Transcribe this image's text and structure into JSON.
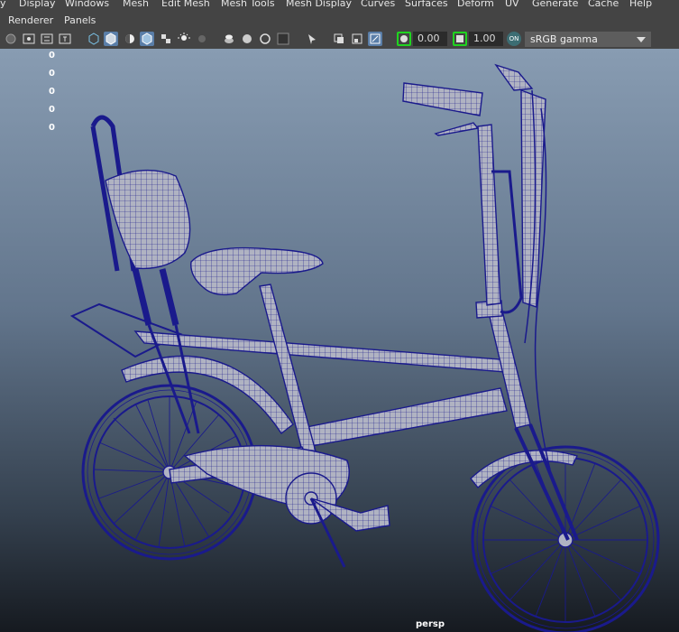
{
  "menu": {
    "items": [
      "y",
      "Display",
      "Windows",
      "Mesh",
      "Edit Mesh",
      "Mesh Tools",
      "Mesh Display",
      "Curves",
      "Surfaces",
      "Deform",
      "UV",
      "Generate",
      "Cache",
      "Help"
    ]
  },
  "panel_menu": {
    "items": [
      "Renderer",
      "Panels"
    ]
  },
  "toolbar": {
    "exposure_value": "0.00",
    "gamma_value": "1.00",
    "color_management_label": "ON",
    "colorspace_selected": "sRGB gamma"
  },
  "viewport": {
    "hud_values": [
      "0",
      "0",
      "0",
      "0",
      "0"
    ],
    "camera_name": "persp"
  },
  "colors": {
    "wireframe": "#1a1a8c",
    "mesh_fill": "#b0b3c2",
    "active_toggle": "#5a7ea8",
    "green_outline": "#1fd41f"
  }
}
